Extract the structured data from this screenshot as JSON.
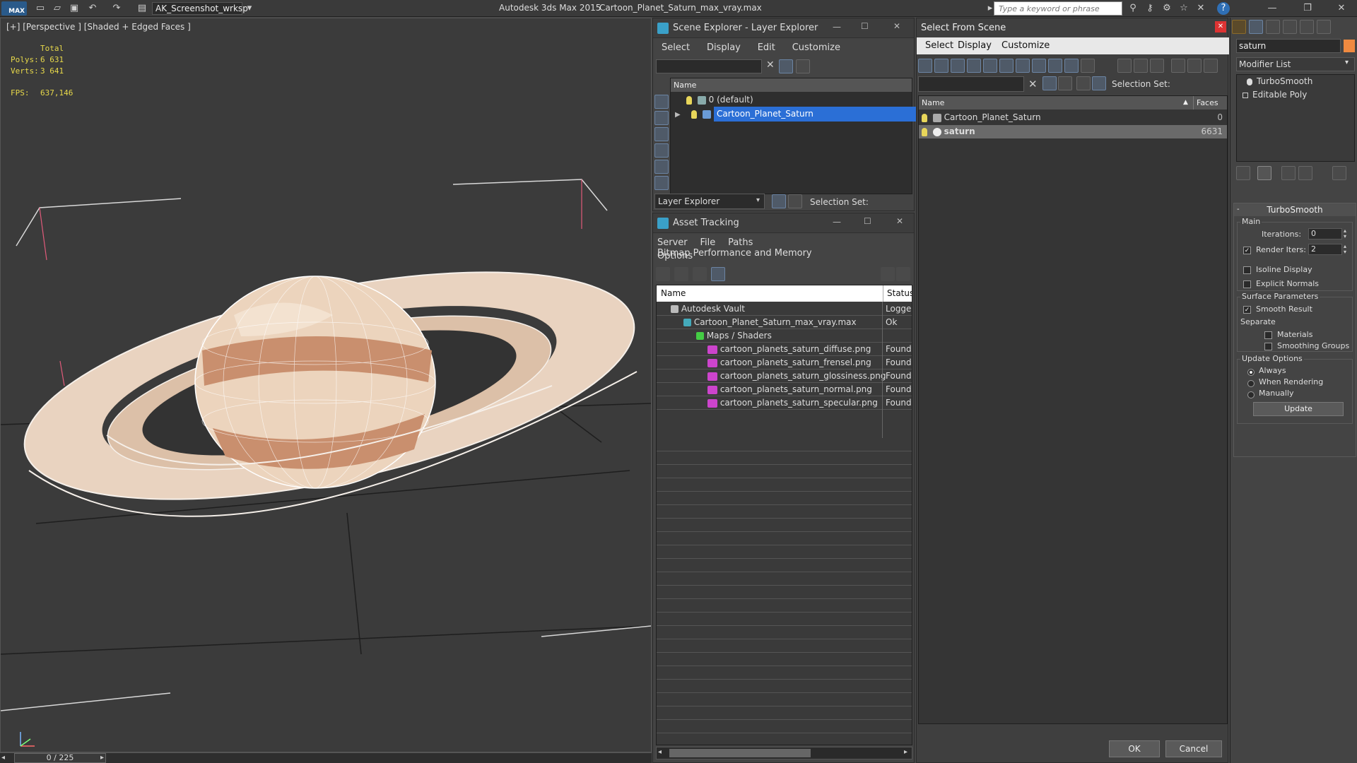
{
  "titlebar": {
    "logo": "MAX",
    "workspace": "AK_Screenshot_wrksp",
    "app_title": "Autodesk 3ds Max  2015",
    "file_title": "Cartoon_Planet_Saturn_max_vray.max",
    "search_placeholder": "Type a keyword or phrase"
  },
  "viewport": {
    "label": "[+] [Perspective ] [Shaded + Edged Faces ]",
    "stats": {
      "total_label": "Total",
      "polys_label": "Polys:",
      "polys_value": "6 631",
      "verts_label": "Verts:",
      "verts_value": "3 641",
      "fps_label": "FPS:",
      "fps_value": "637,146"
    },
    "timeline": "0 / 225"
  },
  "scene_explorer": {
    "title": "Scene Explorer - Layer Explorer",
    "menu": [
      "Select",
      "Display",
      "Edit",
      "Customize"
    ],
    "column_name": "Name",
    "layers": [
      "0 (default)",
      "Cartoon_Planet_Saturn"
    ],
    "footer_dropdown": "Layer Explorer",
    "selection_set_label": "Selection Set:"
  },
  "asset_tracking": {
    "title": "Asset Tracking",
    "menu": [
      "Server",
      "File",
      "Paths",
      "Bitmap Performance and Memory"
    ],
    "menu2": "Options",
    "col_name": "Name",
    "col_status": "Status",
    "rows": [
      {
        "name": "Autodesk Vault",
        "status": "Logged",
        "indent": 0
      },
      {
        "name": "Cartoon_Planet_Saturn_max_vray.max",
        "status": "Ok",
        "indent": 1
      },
      {
        "name": "Maps / Shaders",
        "status": "",
        "indent": 2
      },
      {
        "name": "cartoon_planets_saturn_diffuse.png",
        "status": "Found",
        "indent": 3
      },
      {
        "name": "cartoon_planets_saturn_frensel.png",
        "status": "Found",
        "indent": 3
      },
      {
        "name": "cartoon_planets_saturn_glossiness.png",
        "status": "Found",
        "indent": 3
      },
      {
        "name": "cartoon_planets_saturn_normal.png",
        "status": "Found",
        "indent": 3
      },
      {
        "name": "cartoon_planets_saturn_specular.png",
        "status": "Found",
        "indent": 3
      }
    ]
  },
  "select_from_scene": {
    "title": "Select From Scene",
    "menu": [
      "Select",
      "Display",
      "Customize"
    ],
    "selection_set_label": "Selection Set:",
    "col_name": "Name",
    "col_faces": "Faces",
    "objects": [
      {
        "name": "Cartoon_Planet_Saturn",
        "faces": "0"
      },
      {
        "name": "saturn",
        "faces": "6631"
      }
    ],
    "ok": "OK",
    "cancel": "Cancel"
  },
  "modifier_panel": {
    "object_name": "saturn",
    "modifier_list": "Modifier List",
    "stack": [
      "TurboSmooth",
      "Editable Poly"
    ],
    "rollout_title": "TurboSmooth",
    "main_label": "Main",
    "iterations_label": "Iterations:",
    "iterations_value": "0",
    "render_iters_label": "Render Iters:",
    "render_iters_value": "2",
    "isoline_label": "Isoline Display",
    "explicit_normals_label": "Explicit Normals",
    "surface_params_label": "Surface Parameters",
    "smooth_result_label": "Smooth Result",
    "separate_label": "Separate",
    "materials_label": "Materials",
    "smoothing_groups_label": "Smoothing Groups",
    "update_options_label": "Update Options",
    "always_label": "Always",
    "when_rendering_label": "When Rendering",
    "manually_label": "Manually",
    "update_button": "Update"
  }
}
